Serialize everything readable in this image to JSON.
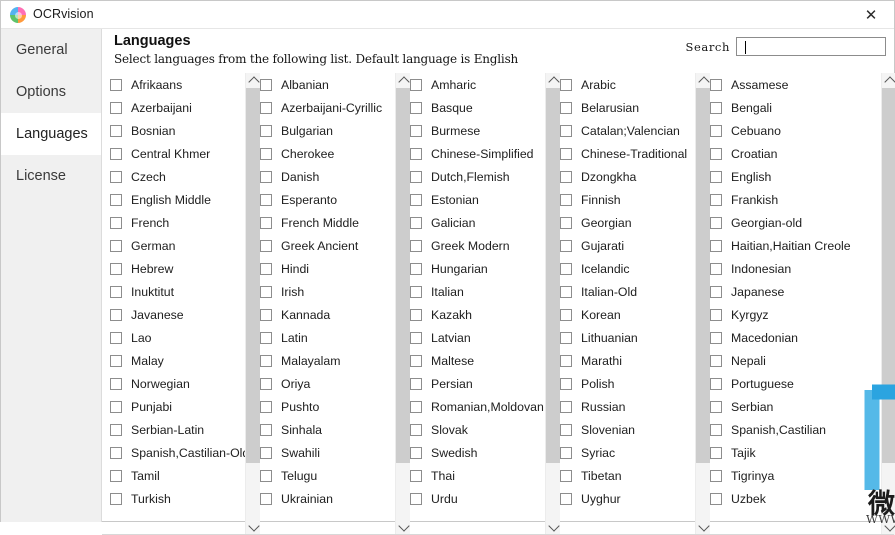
{
  "window": {
    "title": "OCRvision",
    "app_icon": "ocrvision-circle-icon",
    "close_label": "✕"
  },
  "sidebar": {
    "items": [
      {
        "label": "General",
        "selected": false
      },
      {
        "label": "Options",
        "selected": false
      },
      {
        "label": "Languages",
        "selected": true
      },
      {
        "label": "License",
        "selected": false
      }
    ]
  },
  "main": {
    "title": "Languages",
    "subtitle": "Select languages from the following list. Default language is English"
  },
  "search": {
    "label": "Search",
    "value": "",
    "placeholder": ""
  },
  "scrollbar": {
    "up_arrow": "chevron-up",
    "down_arrow": "chevron-down",
    "thumb_position_percent": 0,
    "thumb_size_percent": 83
  },
  "language_columns": [
    {
      "index": 1,
      "items": [
        {
          "label": "Afrikaans",
          "checked": false
        },
        {
          "label": "Azerbaijani",
          "checked": false
        },
        {
          "label": "Bosnian",
          "checked": false
        },
        {
          "label": "Central Khmer",
          "checked": false
        },
        {
          "label": "Czech",
          "checked": false
        },
        {
          "label": "English Middle",
          "checked": false
        },
        {
          "label": "French",
          "checked": false
        },
        {
          "label": "German",
          "checked": false
        },
        {
          "label": "Hebrew",
          "checked": false
        },
        {
          "label": "Inuktitut",
          "checked": false
        },
        {
          "label": "Javanese",
          "checked": false
        },
        {
          "label": "Lao",
          "checked": false
        },
        {
          "label": "Malay",
          "checked": false
        },
        {
          "label": "Norwegian",
          "checked": false
        },
        {
          "label": "Punjabi",
          "checked": false
        },
        {
          "label": "Serbian-Latin",
          "checked": false
        },
        {
          "label": "Spanish,Castilian-Old",
          "checked": false
        },
        {
          "label": "Tamil",
          "checked": false
        },
        {
          "label": "Turkish",
          "checked": false
        }
      ]
    },
    {
      "index": 2,
      "items": [
        {
          "label": "Albanian",
          "checked": false
        },
        {
          "label": "Azerbaijani-Cyrillic",
          "checked": false
        },
        {
          "label": "Bulgarian",
          "checked": false
        },
        {
          "label": "Cherokee",
          "checked": false
        },
        {
          "label": "Danish",
          "checked": false
        },
        {
          "label": "Esperanto",
          "checked": false
        },
        {
          "label": "French Middle",
          "checked": false
        },
        {
          "label": "Greek Ancient",
          "checked": false
        },
        {
          "label": "Hindi",
          "checked": false
        },
        {
          "label": "Irish",
          "checked": false
        },
        {
          "label": "Kannada",
          "checked": false
        },
        {
          "label": "Latin",
          "checked": false
        },
        {
          "label": "Malayalam",
          "checked": false
        },
        {
          "label": "Oriya",
          "checked": false
        },
        {
          "label": "Pushto",
          "checked": false
        },
        {
          "label": "Sinhala",
          "checked": false
        },
        {
          "label": "Swahili",
          "checked": false
        },
        {
          "label": "Telugu",
          "checked": false
        },
        {
          "label": "Ukrainian",
          "checked": false
        }
      ]
    },
    {
      "index": 3,
      "items": [
        {
          "label": "Amharic",
          "checked": false
        },
        {
          "label": "Basque",
          "checked": false
        },
        {
          "label": "Burmese",
          "checked": false
        },
        {
          "label": "Chinese-Simplified",
          "checked": false
        },
        {
          "label": "Dutch,Flemish",
          "checked": false
        },
        {
          "label": "Estonian",
          "checked": false
        },
        {
          "label": "Galician",
          "checked": false
        },
        {
          "label": "Greek Modern",
          "checked": false
        },
        {
          "label": "Hungarian",
          "checked": false
        },
        {
          "label": "Italian",
          "checked": false
        },
        {
          "label": "Kazakh",
          "checked": false
        },
        {
          "label": "Latvian",
          "checked": false
        },
        {
          "label": "Maltese",
          "checked": false
        },
        {
          "label": "Persian",
          "checked": false
        },
        {
          "label": "Romanian,Moldovan",
          "checked": false
        },
        {
          "label": "Slovak",
          "checked": false
        },
        {
          "label": "Swedish",
          "checked": false
        },
        {
          "label": "Thai",
          "checked": false
        },
        {
          "label": "Urdu",
          "checked": false
        }
      ]
    },
    {
      "index": 4,
      "items": [
        {
          "label": "Arabic",
          "checked": false
        },
        {
          "label": "Belarusian",
          "checked": false
        },
        {
          "label": "Catalan;Valencian",
          "checked": false
        },
        {
          "label": "Chinese-Traditional",
          "checked": false
        },
        {
          "label": "Dzongkha",
          "checked": false
        },
        {
          "label": "Finnish",
          "checked": false
        },
        {
          "label": "Georgian",
          "checked": false
        },
        {
          "label": "Gujarati",
          "checked": false
        },
        {
          "label": "Icelandic",
          "checked": false
        },
        {
          "label": "Italian-Old",
          "checked": false
        },
        {
          "label": "Korean",
          "checked": false
        },
        {
          "label": "Lithuanian",
          "checked": false
        },
        {
          "label": "Marathi",
          "checked": false
        },
        {
          "label": "Polish",
          "checked": false
        },
        {
          "label": "Russian",
          "checked": false
        },
        {
          "label": "Slovenian",
          "checked": false
        },
        {
          "label": "Syriac",
          "checked": false
        },
        {
          "label": "Tibetan",
          "checked": false
        },
        {
          "label": "Uyghur",
          "checked": false
        }
      ]
    },
    {
      "index": 5,
      "items": [
        {
          "label": "Assamese",
          "checked": false
        },
        {
          "label": "Bengali",
          "checked": false
        },
        {
          "label": "Cebuano",
          "checked": false
        },
        {
          "label": "Croatian",
          "checked": false
        },
        {
          "label": "English",
          "checked": false
        },
        {
          "label": "Frankish",
          "checked": false
        },
        {
          "label": "Georgian-old",
          "checked": false
        },
        {
          "label": "Haitian,Haitian Creole",
          "checked": false
        },
        {
          "label": "Indonesian",
          "checked": false
        },
        {
          "label": "Japanese",
          "checked": false
        },
        {
          "label": "Kyrgyz",
          "checked": false
        },
        {
          "label": "Macedonian",
          "checked": false
        },
        {
          "label": "Nepali",
          "checked": false
        },
        {
          "label": "Portuguese",
          "checked": false
        },
        {
          "label": "Serbian",
          "checked": false
        },
        {
          "label": "Spanish,Castilian",
          "checked": false
        },
        {
          "label": "Tajik",
          "checked": false
        },
        {
          "label": "Tigrinya",
          "checked": false
        },
        {
          "label": "Uzbek",
          "checked": false
        }
      ]
    }
  ],
  "watermark": {
    "logo": "letter-d-logo",
    "text_cn": "微当下载",
    "url": "WWW.WEIDOWN.COM",
    "color": "#35a8e0"
  }
}
